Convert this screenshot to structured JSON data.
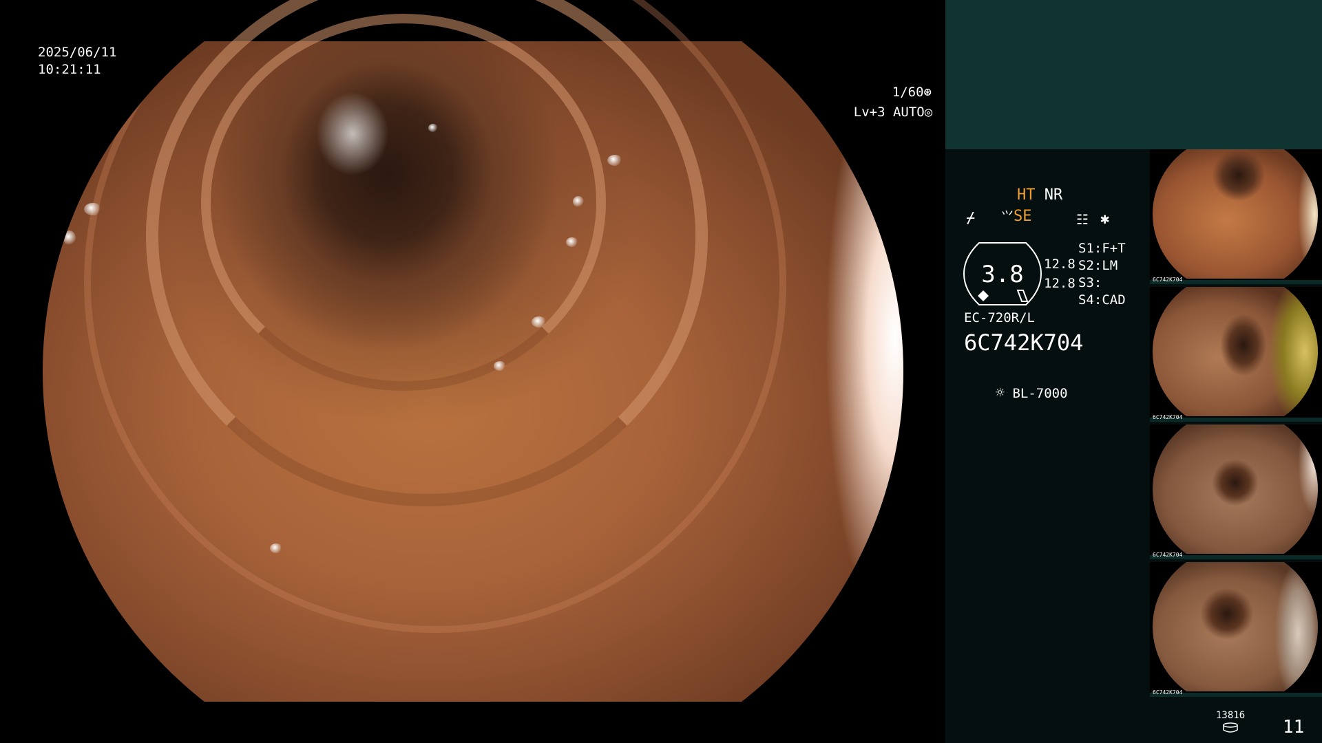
{
  "overlay": {
    "date": "2025/06/11",
    "time": "10:21:11",
    "shutter": "1/60",
    "level": "Lv+3",
    "iris": "AUTO"
  },
  "panel": {
    "mode_ht": "HT",
    "mode_nr": "NR",
    "mode_se": "SE",
    "gauge_value": "3.8",
    "side_value_1": "12.8",
    "side_value_2": "12.8",
    "switches": [
      "S1:F+T",
      "S2:LM",
      "S3:",
      "S4:CAD"
    ],
    "scope_model": "EC-720R/L",
    "scope_serial": "6C742K704",
    "light_source": "BL-7000",
    "storage_count": "13816",
    "image_count": "11",
    "thumb_label": "6C742K704"
  },
  "colors": {
    "accent_orange": "#f0a030",
    "panel_top": "#0f3432",
    "panel_bg": "#050f0f"
  },
  "icons": {
    "shutter": "shutter-icon",
    "iris": "iris-icon",
    "light": "light-source-icon",
    "storage": "storage-icon"
  }
}
